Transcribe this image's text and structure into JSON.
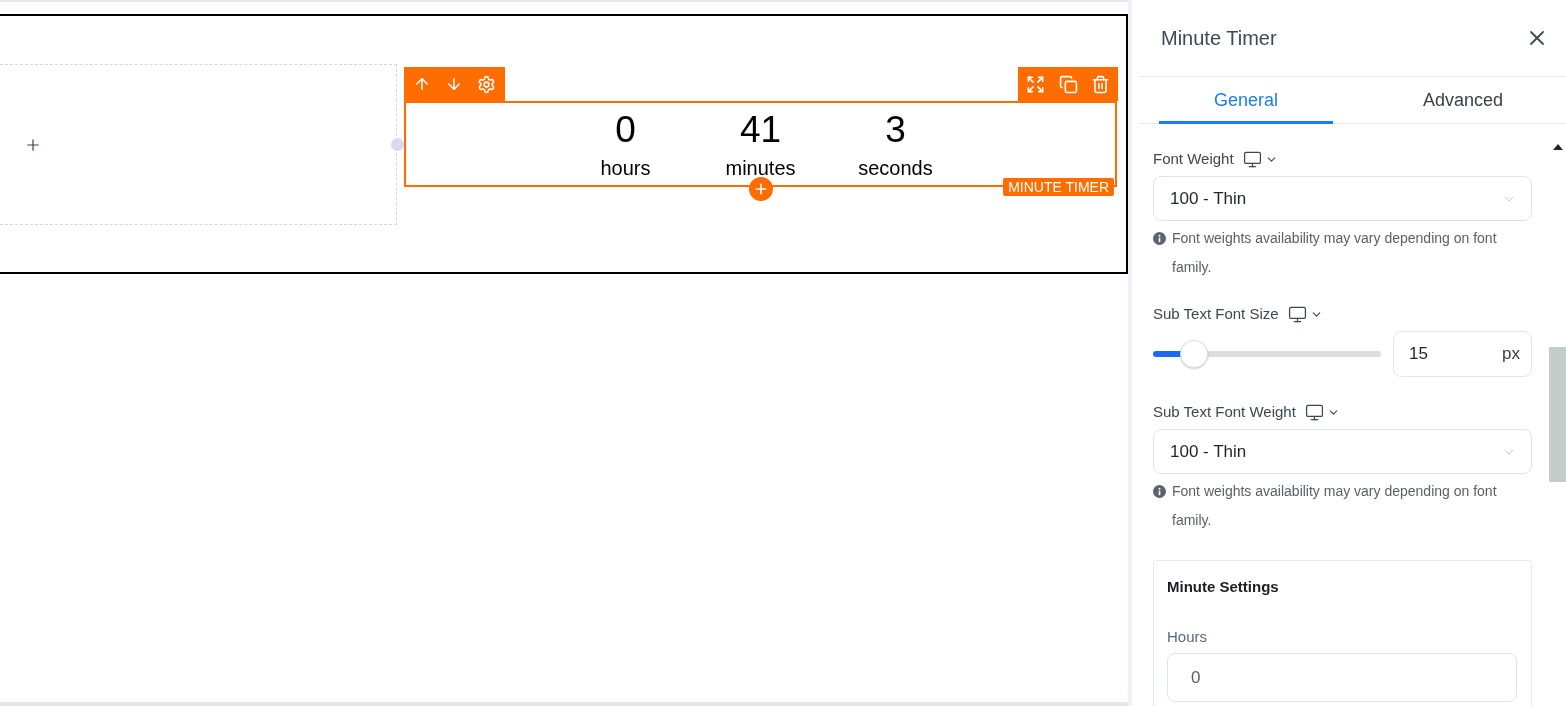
{
  "canvas": {
    "timer_widget": {
      "badge": "MINUTE TIMER",
      "units": [
        {
          "value": "0",
          "label": "hours"
        },
        {
          "value": "41",
          "label": "minutes"
        },
        {
          "value": "3",
          "label": "seconds"
        }
      ]
    }
  },
  "panel": {
    "title": "Minute Timer",
    "tabs": [
      {
        "label": "General",
        "selected": true
      },
      {
        "label": "Advanced",
        "selected": false
      }
    ],
    "controls": [
      {
        "kind": "select",
        "label": "Font Weight",
        "value": "100 - Thin",
        "note": "Font weights availability may vary depending on font family."
      },
      {
        "kind": "slider",
        "label": "Sub Text Font Size",
        "level": 0.18,
        "value": "15",
        "unit": "px"
      },
      {
        "kind": "select",
        "label": "Sub Text Font Weight",
        "value": "100 - Thin",
        "note": "Font weights availability may vary depending on font family."
      }
    ],
    "card": {
      "title": "Minute Settings",
      "fields": [
        {
          "label": "Hours",
          "value": "0"
        }
      ]
    }
  }
}
